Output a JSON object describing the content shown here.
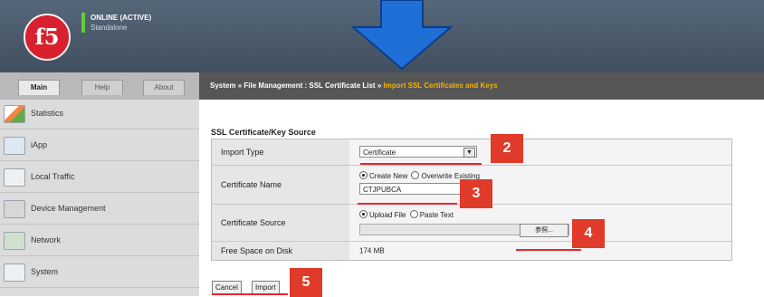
{
  "header": {
    "logo_text": "f5",
    "status_line1": "ONLINE (ACTIVE)",
    "status_line2": "Standalone"
  },
  "tabs": [
    {
      "label": "Main",
      "active": true
    },
    {
      "label": "Help",
      "active": false
    },
    {
      "label": "About",
      "active": false
    }
  ],
  "breadcrumb": {
    "part1": "System",
    "sep": " » ",
    "part2": "File Management : SSL Certificate List",
    "current": "Import SSL Certificates and Keys"
  },
  "sidebar": {
    "items": [
      {
        "label": "Statistics",
        "icon": "statistics-icon"
      },
      {
        "label": "iApp",
        "icon": "iapp-icon"
      },
      {
        "label": "Local Traffic",
        "icon": "local-traffic-icon"
      },
      {
        "label": "Device Management",
        "icon": "device-management-icon"
      },
      {
        "label": "Network",
        "icon": "network-icon"
      },
      {
        "label": "System",
        "icon": "system-icon"
      }
    ]
  },
  "form": {
    "section_title": "SSL Certificate/Key Source",
    "import_type_label": "Import Type",
    "import_type_value": "Certificate",
    "cert_name_label": "Certificate Name",
    "radio_create_new": "Create New",
    "radio_overwrite": "Overwrite Existing",
    "cert_name_value": "CTJPUBCA",
    "cert_source_label": "Certificate Source",
    "radio_upload_file": "Upload File",
    "radio_paste_text": "Paste Text",
    "browse_label": "参照...",
    "free_space_label": "Free Space on Disk",
    "free_space_value": "174 MB"
  },
  "buttons": {
    "cancel": "Cancel",
    "import": "Import"
  },
  "annotations": [
    "2",
    "3",
    "4",
    "5"
  ],
  "colors": {
    "badge": "#e03a2a",
    "arrow": "#1f6fd6",
    "brand_red": "#d8202e",
    "breadcrumb_current": "#f2b200"
  }
}
